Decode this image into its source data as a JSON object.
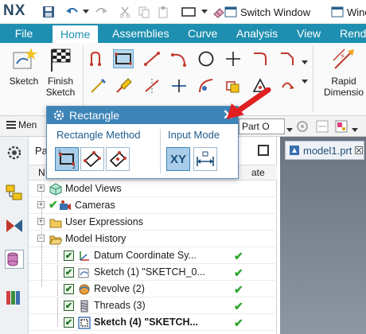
{
  "app": {
    "logo": "NX"
  },
  "quick_access": {
    "switch_window_label": "Switch Window",
    "window_menu_label": "Wind"
  },
  "ribbon_tabs": {
    "file": "File",
    "tabs": [
      "Home",
      "Assemblies",
      "Curve",
      "Analysis",
      "View",
      "Rend"
    ],
    "active": "Home"
  },
  "ribbon": {
    "sketch_label": "Sketch",
    "finish_sketch_label_1": "Finish",
    "finish_sketch_label_2": "Sketch",
    "rapid_label_1": "Rapid",
    "rapid_label_2": "Dimensio"
  },
  "toolbar2": {
    "menu_label": "Men",
    "part_select_value": "Part O"
  },
  "navigator": {
    "title": "Pa",
    "col_name": "N",
    "col_state": "ate",
    "rows": [
      {
        "label": "Model Views",
        "state": ""
      },
      {
        "label": "Cameras",
        "state": ""
      },
      {
        "label": "User Expressions",
        "state": ""
      },
      {
        "label": "Model History",
        "state": ""
      },
      {
        "label": "Datum Coordinate Sy...",
        "state": "✔"
      },
      {
        "label": "Sketch (1) \"SKETCH_0...",
        "state": "✔"
      },
      {
        "label": "Revolve (2)",
        "state": "✔"
      },
      {
        "label": "Threads (3)",
        "state": "✔"
      },
      {
        "label": "Sketch (4) \"SKETCH...",
        "state": "✔"
      }
    ]
  },
  "graphics": {
    "tab_label": "model1.prt"
  },
  "rectangle_dialog": {
    "title": "Rectangle",
    "close_glyph": "✕",
    "method_group_label": "Rectangle Method",
    "input_mode_group_label": "Input Mode",
    "xy_label": "XY"
  },
  "colors": {
    "ribbon_blue": "#1e8fb0",
    "dialog_blue": "#3d84b8",
    "check_green": "#2fa52f",
    "arrow_red": "#e02020"
  }
}
